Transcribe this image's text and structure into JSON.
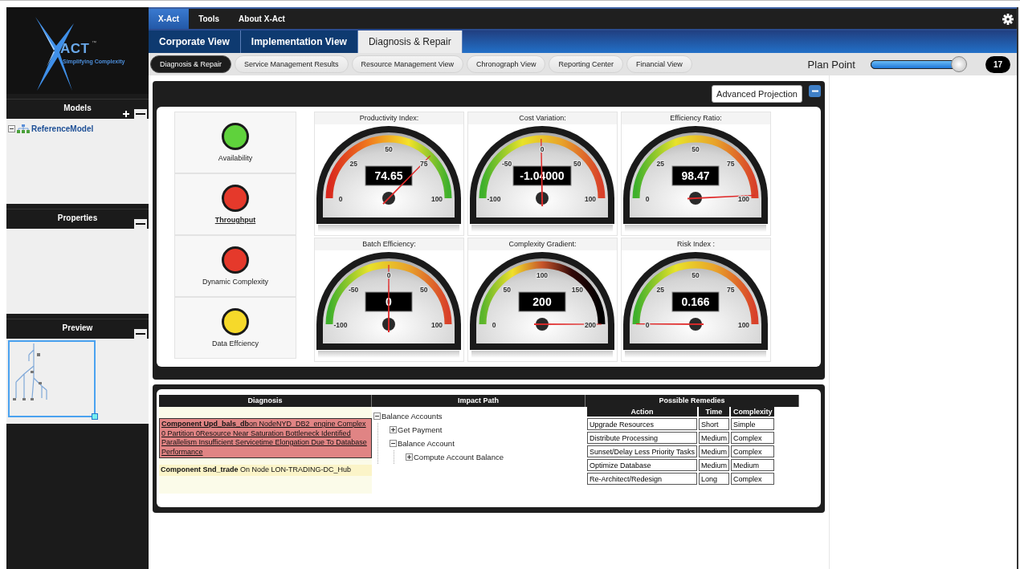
{
  "logo": {
    "wordmark": "ACT",
    "trademark": "™",
    "tagline": "Simplifying Complexity"
  },
  "sidebar": {
    "panels": [
      {
        "title": "Models",
        "kind": "tree",
        "buttons": [
          {
            "kind": "add"
          },
          {
            "kind": "collapse"
          }
        ],
        "tree": [
          {
            "label": "ReferenceModel",
            "expanded": true
          }
        ]
      },
      {
        "title": "Properties",
        "kind": "empty",
        "buttons": [
          {
            "kind": "collapse"
          }
        ]
      },
      {
        "title": "Preview",
        "kind": "preview",
        "buttons": [
          {
            "kind": "collapse"
          }
        ]
      }
    ]
  },
  "menu": [
    {
      "label": "X-Act",
      "selected": true
    },
    {
      "label": "Tools",
      "selected": false
    },
    {
      "label": "About X-Act",
      "selected": false
    }
  ],
  "view_tabs": [
    {
      "label": "Corporate View",
      "selected": false
    },
    {
      "label": "Implementation View",
      "selected": false
    },
    {
      "label": "Diagnosis & Repair",
      "selected": true
    }
  ],
  "sub_tabs": [
    {
      "label": "Diagnosis & Repair",
      "selected": true
    },
    {
      "label": "Service Management Results",
      "selected": false
    },
    {
      "label": "Resource Management View",
      "selected": false
    },
    {
      "label": "Chronograph View",
      "selected": false
    },
    {
      "label": "Reporting Center",
      "selected": false
    },
    {
      "label": "Financial View",
      "selected": false
    }
  ],
  "plan_point": {
    "label": "Plan Point",
    "level": 0.94,
    "value": "17"
  },
  "dashboard": {
    "button": "Advanced Projection",
    "status_lights": [
      {
        "label": "Availability",
        "color": "#5fd23c",
        "underlined": false
      },
      {
        "label": "Throughput",
        "color": "#e5392b",
        "underlined": true
      },
      {
        "label": "Dynamic Complexity",
        "color": "#e5392b",
        "underlined": false
      },
      {
        "label": "Data Effciency",
        "color": "#f6d92a",
        "underlined": false
      }
    ],
    "gauges": [
      {
        "title": "Productivity Index:",
        "kind": "rising",
        "scale": [
          "0",
          "25",
          "50",
          "75",
          "100"
        ],
        "value": "74.65"
      },
      {
        "title": "Cost Variation:",
        "kind": "falling",
        "scale": [
          "-100",
          "-50",
          "0",
          "50",
          "100"
        ],
        "value": "-1.04000"
      },
      {
        "title": "Efficiency Ratio:",
        "kind": "falling",
        "scale": [
          "0",
          "25",
          "50",
          "75",
          "100"
        ],
        "value": "98.47"
      },
      {
        "title": "Batch Efficiency:",
        "kind": "falling",
        "scale": [
          "-100",
          "-50",
          "0",
          "50",
          "100"
        ],
        "value": "0"
      },
      {
        "title": "Complexity Gradient:",
        "kind": "dark",
        "scale": [
          "0",
          "50",
          "100",
          "150",
          "200"
        ],
        "value": "200"
      },
      {
        "title": "Risk Index :",
        "kind": "falling",
        "scale": [
          "0",
          "25",
          "50",
          "75",
          "100"
        ],
        "value": "0.166"
      }
    ]
  },
  "analysis": {
    "diagnosis": {
      "title": "Diagnosis",
      "entries": [
        {
          "text": "**Component Upd_bals_db**on NodeNYD_DB2_engine Complex 0 Partition 0Resource Near Saturation Bottleneck Identified Parallelism Insufficient Servicetime Elongation Due To Database Performance",
          "selected": true
        },
        {
          "text": "**Component Snd_trade** On Node LON-TRADING-DC_Hub",
          "selected": false
        }
      ]
    },
    "impact_path": {
      "title": "Impact Path",
      "tree": [
        {
          "label": "Balance Accounts",
          "expanded": true,
          "children": [
            {
              "label": "Get Payment",
              "expanded": false
            },
            {
              "label": "Balance Account",
              "expanded": true,
              "children": [
                {
                  "label": "Compute Account Balance",
                  "expanded": false
                }
              ]
            }
          ]
        }
      ]
    },
    "remedies": {
      "title": "Possible Remedies",
      "columns": [
        "Action",
        "Time",
        "Complexity"
      ],
      "rows": [
        [
          "Upgrade Resources",
          "Short",
          "Simple"
        ],
        [
          "Distribute Processing",
          "Medium",
          "Complex"
        ],
        [
          "Sunset/Delay Less Priority Tasks",
          "Medium",
          "Complex"
        ],
        [
          "Optimize Database",
          "Medium",
          "Medium"
        ],
        [
          "Re-Architect/Redesign",
          "Long",
          "Complex"
        ]
      ]
    }
  }
}
